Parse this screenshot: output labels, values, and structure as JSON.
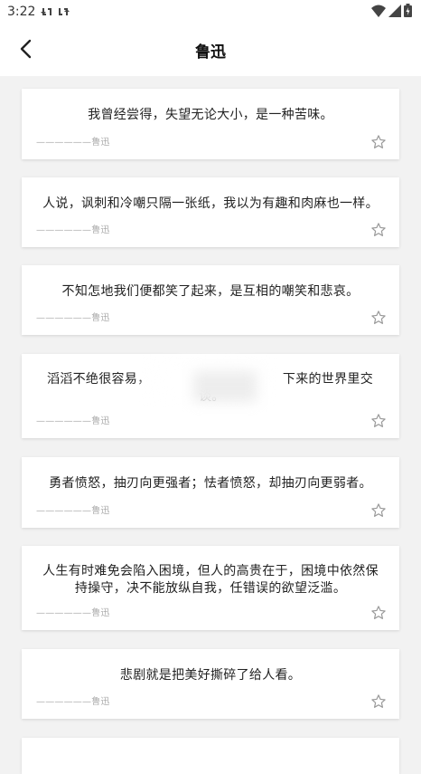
{
  "status_bar": {
    "time": "3:22",
    "icons": [
      "sync-icon",
      "sync-icon",
      "wifi-icon",
      "signal-icon",
      "battery-icon"
    ]
  },
  "header": {
    "title": "鲁迅",
    "back_icon": "back-arrow-icon"
  },
  "quotes": [
    {
      "text": "我曾经尝得，失望无论大小，是一种苦味。",
      "author": "——————鲁迅"
    },
    {
      "text": "人说，讽刺和冷嘲只隔一张纸，我以为有趣和肉麻也一样。",
      "author": "——————鲁迅"
    },
    {
      "text": "不知怎地我们便都笑了起来，是互相的嘲笑和悲哀。",
      "author": "——————鲁迅"
    },
    {
      "text_left": "滔滔不绝很容易，",
      "text_right": "下来的世界里交",
      "text_line2": "谈。",
      "author": "——————鲁迅"
    },
    {
      "text": "勇者愤怒，抽刃向更强者；怯者愤怒，却抽刃向更弱者。",
      "author": "——————鲁迅"
    },
    {
      "text": "人生有时难免会陷入困境，但人的高贵在于，困境中依然保持操守，决不能放纵自我，任错误的欲望泛滥。",
      "author": "——————鲁迅"
    },
    {
      "text": "悲剧就是把美好撕碎了给人看。",
      "author": "——————鲁迅"
    }
  ],
  "colors": {
    "background": "#f2f2f2",
    "card": "#ffffff",
    "text": "#222222",
    "muted": "#aaaaaa"
  }
}
